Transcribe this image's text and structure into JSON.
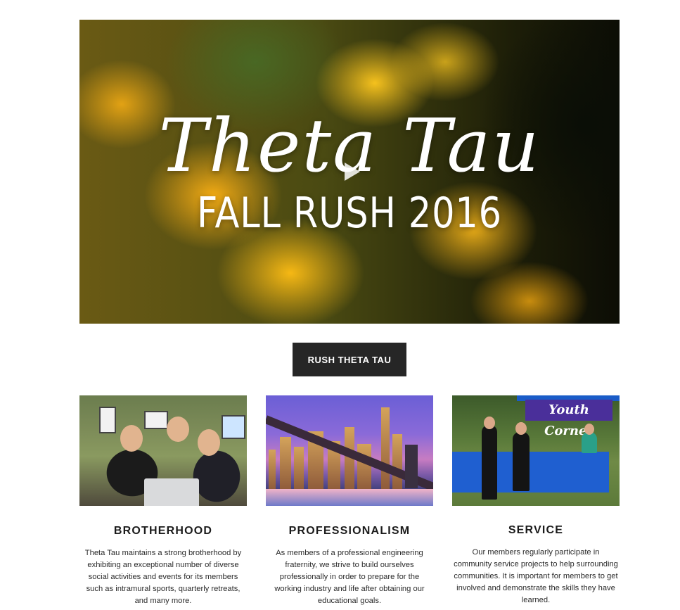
{
  "hero": {
    "script_title": "Theta Tau",
    "subtitle": "FALL RUSH 2016"
  },
  "cta": {
    "label": "RUSH THETA TAU"
  },
  "cards": [
    {
      "title": "BROTHERHOOD",
      "body": "Theta Tau maintains a strong brotherhood by exhibiting an exceptional number of diverse social activities and events for its members such as intramural sports, quarterly retreats, and many more."
    },
    {
      "title": "PROFESSIONALISM",
      "body": "As members of a professional engineering fraternity, we strive to build ourselves professionally in order to prepare for the working industry and life after obtaining our educational goals."
    },
    {
      "title": "SERVICE",
      "body": "Our members regularly participate in community service projects to help surrounding communities. It is important for members to get involved and demonstrate the skills they have learned.",
      "image_banner": "Youth Corner"
    }
  ]
}
